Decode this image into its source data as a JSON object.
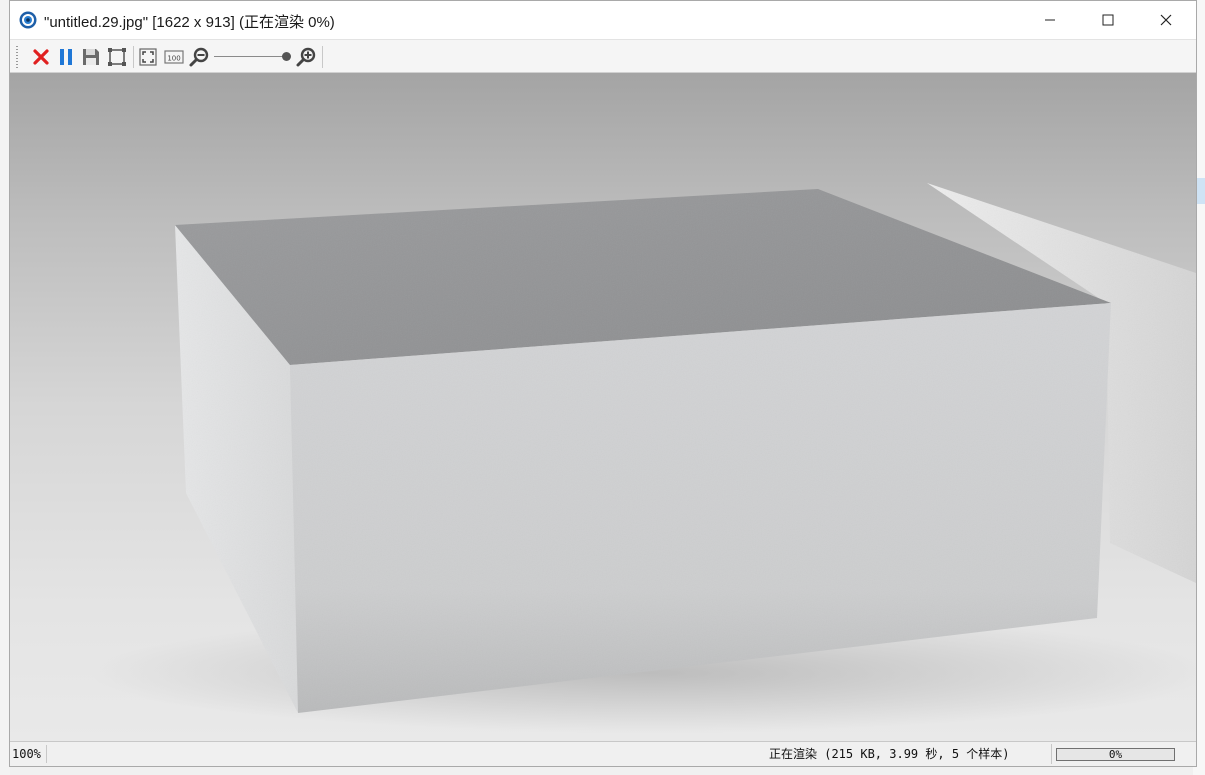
{
  "window": {
    "title": "\"untitled.29.jpg\" [1622 x 913] (正在渲染 0%)",
    "app_icon": "keyshot-icon"
  },
  "toolbar": {
    "buttons": [
      {
        "name": "stop-render-button",
        "icon": "red-x-icon"
      },
      {
        "name": "pause-button",
        "icon": "pause-icon"
      },
      {
        "name": "save-button",
        "icon": "floppy-icon"
      },
      {
        "name": "crop-region-button",
        "icon": "region-icon"
      },
      {
        "name": "fit-view-button",
        "icon": "fit-icon"
      },
      {
        "name": "actual-size-button",
        "icon": "100-icon",
        "label": "100"
      },
      {
        "name": "zoom-out-button",
        "icon": "zoom-out-icon"
      },
      {
        "name": "zoom-in-button",
        "icon": "zoom-in-icon"
      }
    ],
    "zoom_slider_level": 1.0
  },
  "render": {
    "subject": "grey box on seamless background"
  },
  "status": {
    "zoom": "100%",
    "text": "正在渲染 (215 KB, 3.99 秒, 5 个样本)",
    "progress_label": "0%",
    "progress_fraction": 0.0
  },
  "colors": {
    "close_red": "#e02020",
    "pause_blue": "#1f77d6",
    "progress_green": "#06b025"
  }
}
